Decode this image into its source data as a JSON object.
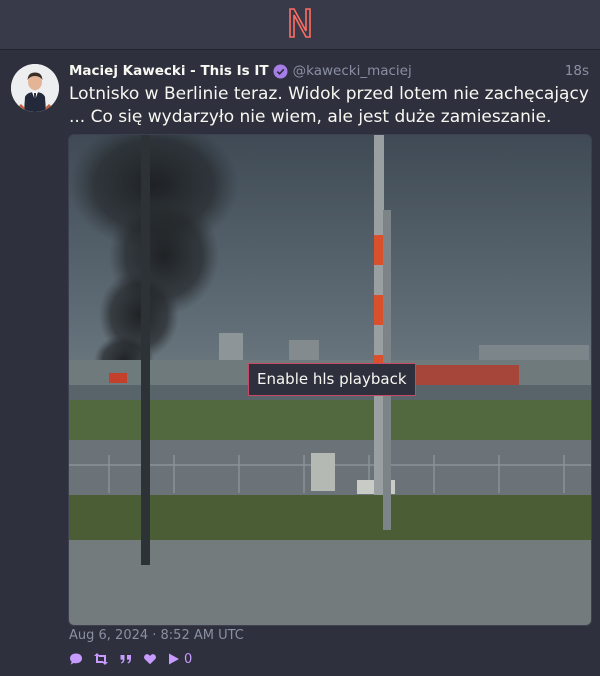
{
  "brand": {
    "logo_letter": "N",
    "accent": "#ff6c60"
  },
  "tweet": {
    "author": {
      "fullname": "Maciej Kawecki - This Is IT",
      "username": "@kawecki_maciej",
      "verified": true
    },
    "time_ago": "18s",
    "text_line_1": "Lotnisko w Berlinie teraz. Widok przed lotem nie zachęcający",
    "text_line_2": "... Co się wydarzyło nie wiem, ale jest duże zamieszanie.",
    "media": {
      "type": "video",
      "playback_button_label": "Enable hls playback"
    },
    "date": "Aug 6, 2024 · 8:52 AM UTC",
    "stats": {
      "replies_icon": "comment-icon",
      "retweets_icon": "retweet-icon",
      "quotes_icon": "quote-icon",
      "likes_icon": "heart-icon",
      "views_icon": "play-icon",
      "views": "0"
    }
  },
  "colors": {
    "background": "#282a36",
    "text": "#f8f8f2",
    "muted": "#8a8fa3",
    "accent_purple": "#c79bff",
    "button_border": "#c74966"
  }
}
